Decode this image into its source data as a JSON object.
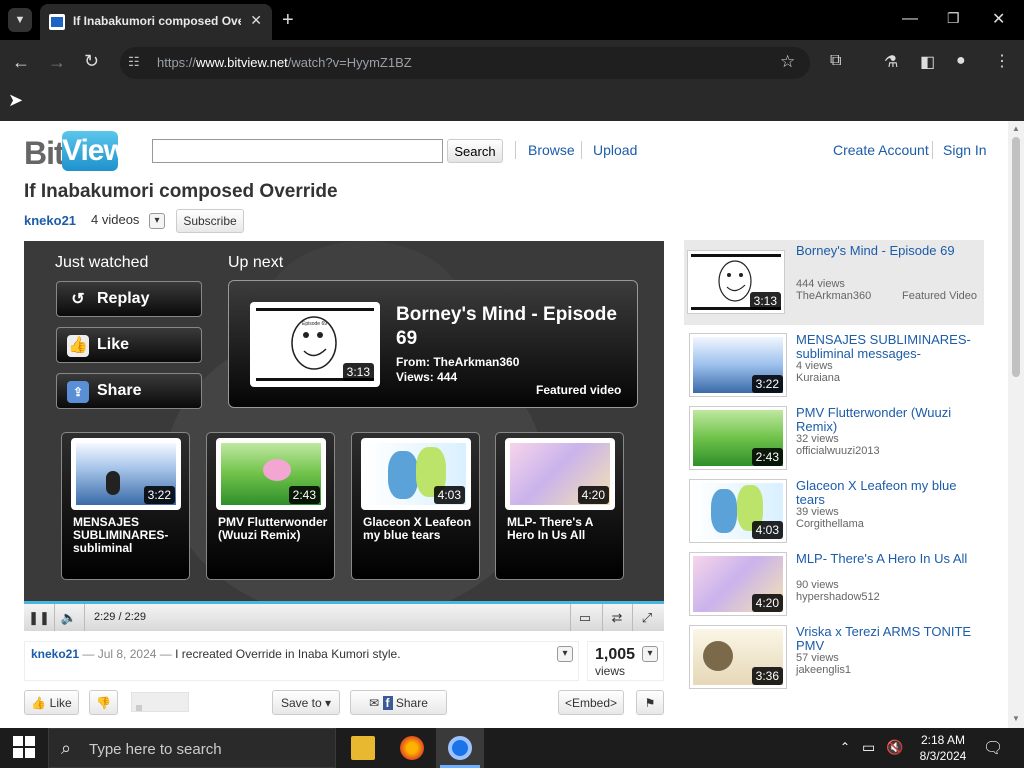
{
  "browser": {
    "tab_title": "If Inabakumori composed Override",
    "url_prefix": "https://",
    "url_host": "www.bitview.net",
    "url_path": "/watch?v=HyymZ1BZ"
  },
  "site": {
    "logo_bit": "Bit",
    "logo_view": "View",
    "search_button": "Search",
    "search_value": "",
    "nav": [
      "Browse",
      "Upload"
    ],
    "account": [
      "Create Account",
      "Sign In"
    ]
  },
  "video": {
    "title": "If Inabakumori composed Override",
    "channel": "kneko21",
    "video_count": "4 videos",
    "subscribe": "Subscribe",
    "time": "2:29 / 2:29",
    "description": {
      "user": "kneko21",
      "date": "— Jul 8, 2024 —",
      "text": "I recreated Override in Inaba Kumori style."
    },
    "views_number": "1,005",
    "views_label": "views"
  },
  "endscreen": {
    "just_watched": "Just watched",
    "up_next": "Up next",
    "replay": "Replay",
    "like": "Like",
    "share": "Share",
    "next": {
      "title": "Borney's Mind - Episode 69",
      "from": "From: TheArkman360",
      "views": "Views: 444",
      "duration": "3:13",
      "featured": "Featured video",
      "thumb_text": "Episode 69"
    },
    "cards": [
      {
        "title": "MENSAJES SUBLIMINARES-subliminal",
        "duration": "3:22"
      },
      {
        "title": "PMV Flutterwonder (Wuuzi Remix)",
        "duration": "2:43"
      },
      {
        "title": "Glaceon X Leafeon my blue tears",
        "duration": "4:03"
      },
      {
        "title": "MLP- There's A Hero In Us All",
        "duration": "4:20"
      }
    ]
  },
  "actions": {
    "like": "Like",
    "save_to": "Save to",
    "share": "Share",
    "embed": "<Embed>"
  },
  "sidebar": [
    {
      "title": "Borney's Mind - Episode 69",
      "views": "444 views",
      "user": "TheArkman360",
      "badge": "Featured Video",
      "duration": "3:13"
    },
    {
      "title": "MENSAJES SUBLIMINARES-subliminal messages-",
      "views": "4 views",
      "user": "Kuraiana",
      "badge": "",
      "duration": "3:22"
    },
    {
      "title": "PMV Flutterwonder (Wuuzi Remix)",
      "views": "32 views",
      "user": "officialwuuzi2013",
      "badge": "",
      "duration": "2:43"
    },
    {
      "title": "Glaceon X Leafeon my blue tears",
      "views": "39 views",
      "user": "Corgithellama",
      "badge": "",
      "duration": "4:03"
    },
    {
      "title": "MLP- There's A Hero In Us All",
      "views": "90 views",
      "user": "hypershadow512",
      "badge": "",
      "duration": "4:20"
    },
    {
      "title": "Vriska x Terezi ARMS TONITE PMV",
      "views": "57 views",
      "user": "jakeenglis1",
      "badge": "",
      "duration": "3:36"
    }
  ],
  "taskbar": {
    "search_placeholder": "Type here to search",
    "time": "2:18 AM",
    "date": "8/3/2024"
  },
  "colors": {
    "link": "#1c5ca8",
    "progress": "#4ab5e0",
    "tabbar": "#000000",
    "toolbar": "#292929"
  }
}
